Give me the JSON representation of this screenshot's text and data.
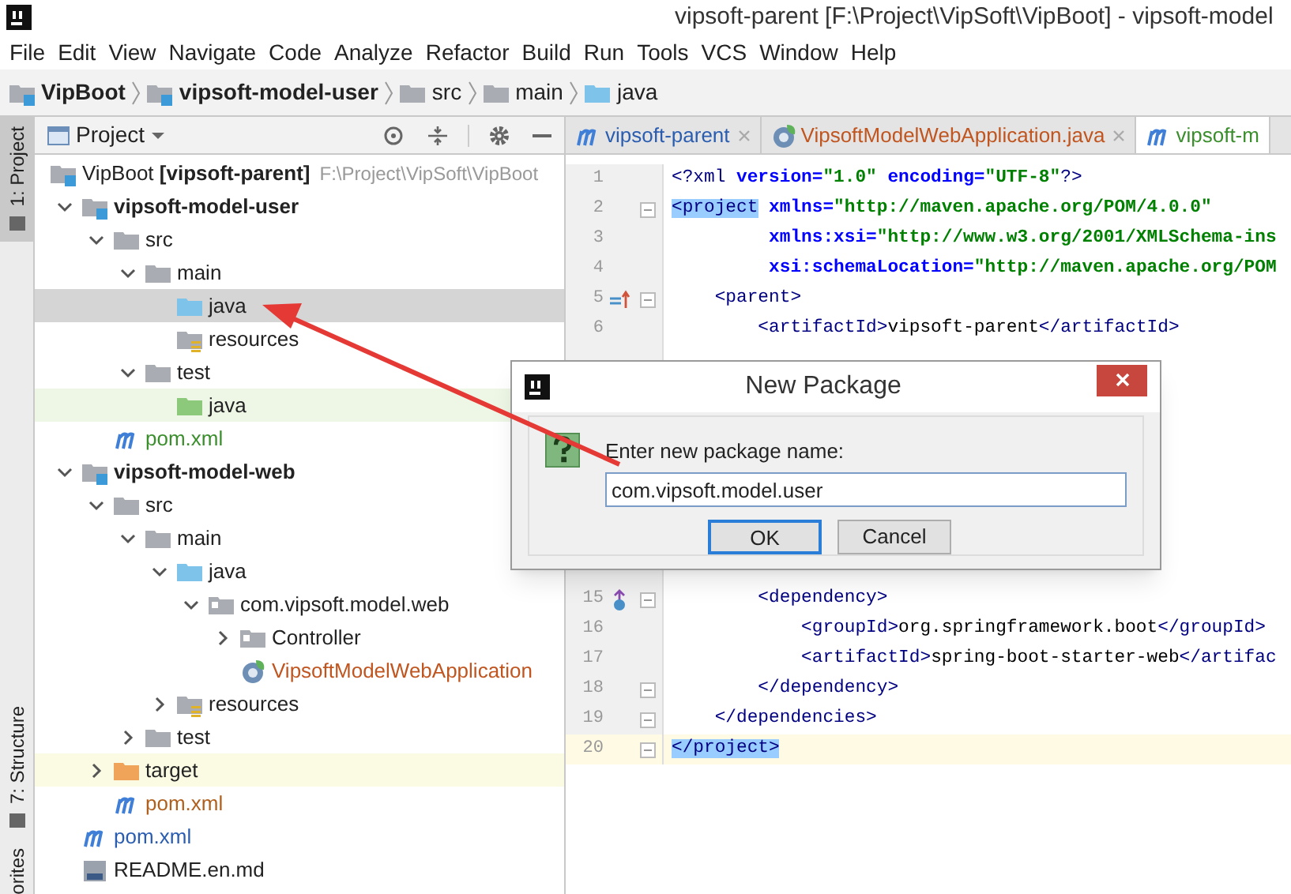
{
  "window": {
    "title": "vipsoft-parent [F:\\Project\\VipSoft\\VipBoot] - vipsoft-model"
  },
  "menu": [
    "File",
    "Edit",
    "View",
    "Navigate",
    "Code",
    "Analyze",
    "Refactor",
    "Build",
    "Run",
    "Tools",
    "VCS",
    "Window",
    "Help"
  ],
  "breadcrumbs": [
    {
      "label": "VipBoot",
      "kind": "project"
    },
    {
      "label": "vipsoft-model-user",
      "kind": "module"
    },
    {
      "label": "src",
      "kind": "folder"
    },
    {
      "label": "main",
      "kind": "folder"
    },
    {
      "label": "java",
      "kind": "source"
    }
  ],
  "side_tabs": [
    {
      "label": "1: Project",
      "selected": true
    },
    {
      "label": "7: Structure",
      "selected": false
    },
    {
      "label": "orites",
      "selected": false
    }
  ],
  "project_panel": {
    "title": "Project",
    "tree": [
      {
        "label": "VipBoot **[vipsoft-parent]**",
        "path": "F:\\Project\\VipSoft\\VipBoot",
        "kind": "module",
        "selected": false,
        "children": [
          {
            "label": "vipsoft-model-user",
            "kind": "module",
            "selected": false,
            "expanded": true,
            "children": [
              {
                "label": "src",
                "kind": "folder",
                "selected": false,
                "expanded": true,
                "children": [
                  {
                    "label": "main",
                    "kind": "folder",
                    "selected": false,
                    "expanded": true,
                    "children": [
                      {
                        "label": "java",
                        "kind": "source",
                        "selected": true
                      },
                      {
                        "label": "resources",
                        "kind": "resources",
                        "selected": false
                      }
                    ]
                  },
                  {
                    "label": "test",
                    "kind": "folder",
                    "selected": false,
                    "expanded": true,
                    "children": [
                      {
                        "label": "java",
                        "kind": "test",
                        "selected": false
                      }
                    ]
                  }
                ]
              },
              {
                "label": "pom.xml",
                "kind": "maven",
                "selected": false,
                "color": "#3a8e2c"
              }
            ]
          },
          {
            "label": "vipsoft-model-web",
            "kind": "module",
            "selected": false,
            "expanded": true,
            "children": [
              {
                "label": "src",
                "kind": "folder",
                "selected": false,
                "expanded": true,
                "children": [
                  {
                    "label": "main",
                    "kind": "folder",
                    "selected": false,
                    "expanded": true,
                    "children": [
                      {
                        "label": "java",
                        "kind": "source",
                        "selected": false,
                        "expanded": true,
                        "children": [
                          {
                            "label": "com.vipsoft.model.web",
                            "kind": "package",
                            "selected": false,
                            "expanded": true,
                            "children": [
                              {
                                "label": "Controller",
                                "kind": "package",
                                "selected": false,
                                "expanded": false
                              },
                              {
                                "label": "VipsoftModelWebApplication",
                                "kind": "class",
                                "selected": false,
                                "color": "#c0551f"
                              }
                            ]
                          }
                        ]
                      },
                      {
                        "label": "resources",
                        "kind": "resources",
                        "selected": false,
                        "expanded": false
                      }
                    ]
                  },
                  {
                    "label": "test",
                    "kind": "folder",
                    "selected": false,
                    "expanded": false
                  }
                ]
              },
              {
                "label": "target",
                "kind": "excluded",
                "selected": false,
                "expanded": false
              },
              {
                "label": "pom.xml",
                "kind": "maven",
                "selected": false,
                "color": "#b0601e"
              }
            ]
          },
          {
            "label": "pom.xml",
            "kind": "maven",
            "selected": false,
            "color": "#2a5db0"
          },
          {
            "label": "README.en.md",
            "kind": "markdown",
            "selected": false
          }
        ]
      }
    ]
  },
  "editor_tabs": [
    {
      "label": "vipsoft-parent",
      "kind": "maven",
      "color": "#2a5db0",
      "selected": false
    },
    {
      "label": "VipsoftModelWebApplication.java",
      "kind": "class",
      "color": "#c0551f",
      "selected": false
    },
    {
      "label": "vipsoft-m",
      "kind": "maven",
      "color": "#3a8e2c",
      "selected": true
    }
  ],
  "code_lines": [
    {
      "number": "1",
      "current": false,
      "fold": false,
      "tokens": [
        {
          "kind": "tag",
          "text": "<?xml "
        },
        {
          "kind": "attr",
          "text": "version="
        },
        {
          "kind": "value",
          "text": "\"1.0\" "
        },
        {
          "kind": "attr",
          "text": "encoding="
        },
        {
          "kind": "value",
          "text": "\"UTF-8\""
        },
        {
          "kind": "tag",
          "text": "?>"
        }
      ]
    },
    {
      "number": "2",
      "current": false,
      "fold": true,
      "tokens": [
        {
          "kind": "match",
          "text": "<project"
        },
        {
          "kind": "attr",
          "text": " xmlns="
        },
        {
          "kind": "value",
          "text": "\"http://maven.apache.org/POM/4.0.0\""
        }
      ]
    },
    {
      "number": "3",
      "current": false,
      "fold": false,
      "tokens": [
        {
          "kind": "attr",
          "text": "         xmlns:xsi="
        },
        {
          "kind": "value",
          "text": "\"http://www.w3.org/2001/XMLSchema-ins"
        }
      ]
    },
    {
      "number": "4",
      "current": false,
      "fold": false,
      "tokens": [
        {
          "kind": "attr",
          "text": "         xsi:schemaLocation="
        },
        {
          "kind": "value",
          "text": "\"http://maven.apache.org/POM"
        }
      ]
    },
    {
      "number": "5",
      "current": false,
      "fold": true,
      "gutter": {
        "kind": "parent"
      },
      "tokens": [
        {
          "kind": "tag",
          "text": "    <parent>"
        }
      ]
    },
    {
      "number": "6",
      "current": false,
      "fold": false,
      "tokens": [
        {
          "kind": "tag",
          "text": "        <artifactId>"
        },
        {
          "kind": "text",
          "text": "vipsoft-parent"
        },
        {
          "kind": "tag",
          "text": "</artifactId>"
        }
      ]
    },
    {
      "number": "15",
      "current": false,
      "fold": true,
      "gutter": {
        "kind": "implemented"
      },
      "tokens": [
        {
          "kind": "tag",
          "text": "        <dependency>"
        }
      ]
    },
    {
      "number": "16",
      "current": false,
      "fold": false,
      "tokens": [
        {
          "kind": "tag",
          "text": "            <groupId>"
        },
        {
          "kind": "text",
          "text": "org.springframework.boot"
        },
        {
          "kind": "tag",
          "text": "</groupId>"
        }
      ]
    },
    {
      "number": "17",
      "current": false,
      "fold": false,
      "tokens": [
        {
          "kind": "tag",
          "text": "            <artifactId>"
        },
        {
          "kind": "text",
          "text": "spring-boot-starter-web"
        },
        {
          "kind": "tag",
          "text": "</artifac"
        }
      ]
    },
    {
      "number": "18",
      "current": false,
      "fold": true,
      "tokens": [
        {
          "kind": "tag",
          "text": "        </dependency>"
        }
      ]
    },
    {
      "number": "19",
      "current": false,
      "fold": true,
      "tokens": [
        {
          "kind": "tag",
          "text": "    </dependencies>"
        }
      ]
    },
    {
      "number": "20",
      "current": true,
      "fold": true,
      "tokens": [
        {
          "kind": "match",
          "text": "</project>"
        }
      ]
    }
  ],
  "dialog": {
    "title": "New Package",
    "prompt": "Enter new package name:",
    "value": "com.vipsoft.model.user",
    "buttons": [
      {
        "label": "OK",
        "selected": true
      },
      {
        "label": "Cancel",
        "selected": false
      }
    ]
  }
}
